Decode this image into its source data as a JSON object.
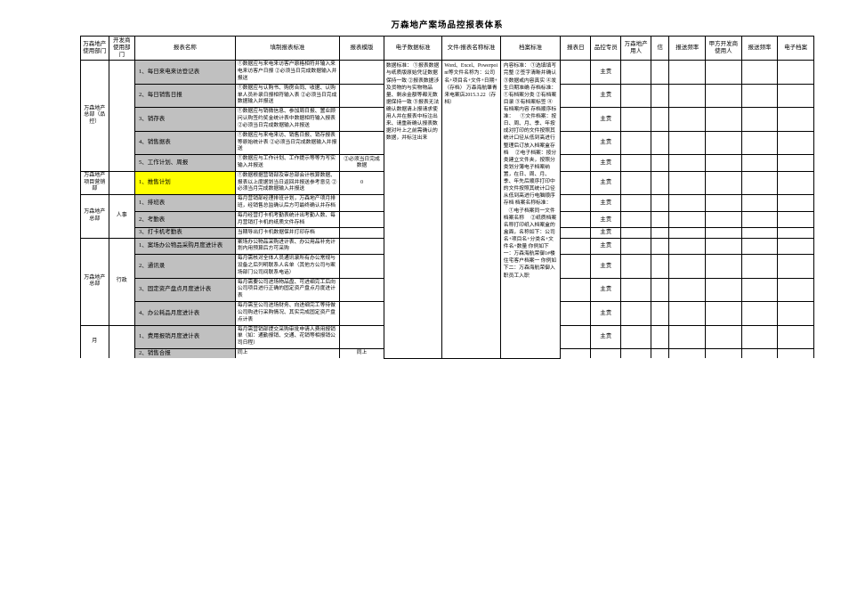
{
  "title": "万森地产案场品控报表体系",
  "headers": [
    "万森地产使用部门",
    "开发商使用部门",
    "报表名称",
    "填制报表标准",
    "报表模版",
    "电子数据标准",
    "文件/报表名称标准",
    "档案标准",
    "报表日",
    "品控专员",
    "万森地产用人",
    "信",
    "报送频率",
    "甲方开发商使用人",
    "报送频率",
    "电子档案"
  ],
  "col6_text": "数据标准：\n①报表数据与纸质版原始凭证数据保持一致\n②报表数据涉及货物的与实物物品量、剩余金额等都无数据保持一致\n③报表无法确认数据请上报请求使用人并在报表中标注出来、请重新确认报表数据对叶上之前需确认的数据，并标注出来",
  "col7_text": "Word、Excel、Powerpoint等文件名称为：公司名+项目名+文件+日期+（存档）\n万森海航肇青来电案店2015.3.22（存档）",
  "col8_text": "内容标准：\n①选填填写完整\n②签字清晰并确认\n③数据或内容真实\n④发生日期准确\n存档标准：\n①有档案分类\n②有档案目录\n③有档案标签\n④有档案内容\n存档顺序标准：\n　①文件档案：按日、周、月、季、年按成对打印的文件按照其统计口径从低到高进行整理后订放入档案盒存档\n　②电子档案：按分类建立文件夹，按照分类划分薄电子档案纳置，在日、周、月、季、年先后顺序打印中的文件按照其统计口径从低到高进行电脑顺序存档\n档案名称标准：\n　①电子档案同一文件档案名称\n　②纸质档案名称打印纸入档案盒的盒面，名称如下：公司名+项目名+分类名+文件名+数量\n你例如下一：万森海航荣御1#楼住宅客户档案一\n你例如下二：万森海航荣御入职员工入职",
  "rows": [
    {
      "dept1": "万森地产总部（品控）",
      "dept2": "",
      "name": "1、每日来电来访登记表",
      "std": "①数据应与来电来访客户原格相符并输入来电来访客户日报\n②必须当日完成数据输入并报送",
      "freq": "主责"
    },
    {
      "name": "2、每日销售日报",
      "std": "①数据应与认购书、购房合同、收据、认购单人员补录日报相符输入表\n②必须当日完成数据输入并报送",
      "freq": "主责"
    },
    {
      "name": "3、销存表",
      "std": "①数据应与销微信息、参加周日报、置业顾问认购签约奖金统计表中数据相符输入报表\n②必须当日完成数据输入并报送",
      "freq": "主责"
    },
    {
      "name": "4、销售据表",
      "std": "①数据应与来电来访、销售日报、销存报表等原始统计表\n②必须当日完成数据输入并报送",
      "freq": "主责"
    },
    {
      "name": "5、工作计划、周报",
      "std": "①数据应与工作计划、工作提示等等为写实输入并报送",
      "col5": "②必须当日完成数据",
      "freq": "主责"
    },
    {
      "dept1": "万森地产项目营销部",
      "dept2": "",
      "name": "1、推售计划",
      "hl": true,
      "std": "①数据根据营销部及审总部会计核算数据、报表以上度据划当日返回并报送参考意见\n②必须当月完成数据输入并报送",
      "col5": "0",
      "freq": "主责"
    },
    {
      "dept1": "万森地产总部",
      "dept1b": "人事",
      "name": "1、排班表",
      "std": "每月营销部经理排班计划，万森地产项月排班，经销售总监确认后方可最终确认并存档",
      "freq": "主责"
    },
    {
      "name": "2、考勤表",
      "std": "每月经营打卡机考勤表统计出考勤人数、每月营销打卡机的纸质文件存档",
      "freq": "主责"
    },
    {
      "name": "3、打卡机考勤表",
      "std": "当期导出打卡机数据保并打印存档",
      "freq": "主责"
    },
    {
      "dept1": "万森地产总部",
      "dept1b": "行政",
      "name": "1、案场办公物品采购月度进计表",
      "std": "案场办公物品采购进计表、办公用品补充计划内用预算后方可采购",
      "freq": "主责"
    },
    {
      "name": "2、通讯录",
      "std": "每月需核对全体人员通讯录所有办公常规与设备之后列明联系人名单（其他方公司与案场部门公司间联系电话）",
      "freq": "主责"
    },
    {
      "name": "3、固定资产盘点月度进计表",
      "std": "每月需要公司进场物品盘、可进细完工后向公司项目进行正确的固定资产盘点月度进计表",
      "freq": "主责"
    },
    {
      "name": "4、办公耗品月度进计表",
      "std": "每月需至公司进场财务、向进细完工等待做公司购进行采购情况、其实完成固定资产盘点计表",
      "freq": "主责"
    },
    {
      "dept1_rowspan_start": true,
      "name": "1、费用报销月度进计表",
      "std": "每月需营销部提交采购审批申请人费用报销单（如：通勤报销、交通、花销等相报销公司日程）",
      "freq": "主责"
    },
    {
      "name": "2、销售合报",
      "std": "同上",
      "col5": "同上",
      "freq": ""
    }
  ],
  "side_label_left": "月"
}
